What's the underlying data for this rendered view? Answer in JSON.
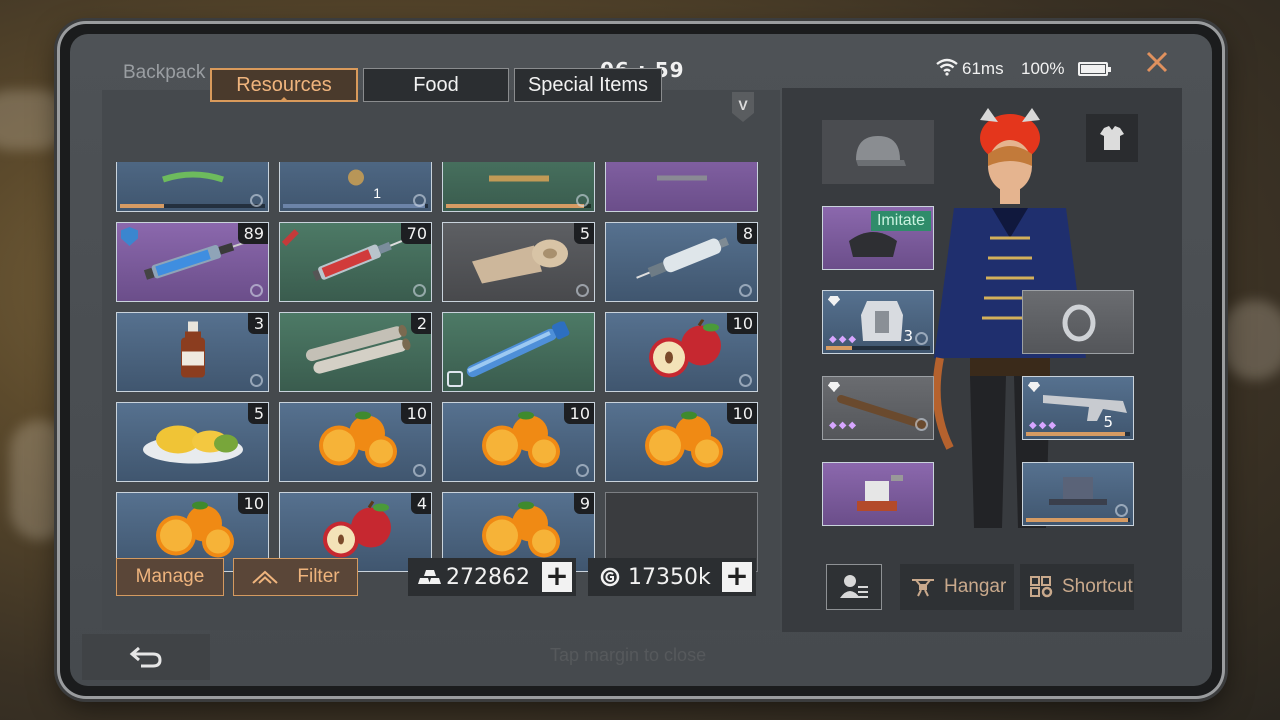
{
  "status_bar": {
    "title": "Backpack",
    "time": "06 : 59",
    "ping": "61ms",
    "battery": "100%"
  },
  "tabs": [
    {
      "label": "Resources",
      "active": true
    },
    {
      "label": "Food",
      "active": false
    },
    {
      "label": "Special Items",
      "active": false
    }
  ],
  "v_badge": "V",
  "items": [
    {
      "name": "partial-green-item",
      "rarity": "blue",
      "qty": ""
    },
    {
      "name": "partial-item",
      "rarity": "blue",
      "qty": "1"
    },
    {
      "name": "partial-item",
      "rarity": "green",
      "qty": ""
    },
    {
      "name": "partial-item",
      "rarity": "purple",
      "qty": ""
    },
    {
      "name": "blue-syringe",
      "rarity": "purple",
      "qty": "89"
    },
    {
      "name": "red-syringe",
      "rarity": "green",
      "qty": "70"
    },
    {
      "name": "bandage",
      "rarity": "gray",
      "qty": "5"
    },
    {
      "name": "white-syringe",
      "rarity": "blue",
      "qty": "8"
    },
    {
      "name": "medicine-bottle",
      "rarity": "blue",
      "qty": "3"
    },
    {
      "name": "logs",
      "rarity": "green",
      "qty": "2"
    },
    {
      "name": "blue-test-tube",
      "rarity": "green",
      "qty": ""
    },
    {
      "name": "apples",
      "rarity": "blue",
      "qty": "10"
    },
    {
      "name": "mango-plate",
      "rarity": "blue",
      "qty": "5"
    },
    {
      "name": "oranges",
      "rarity": "blue",
      "qty": "10"
    },
    {
      "name": "oranges",
      "rarity": "blue",
      "qty": "10"
    },
    {
      "name": "oranges",
      "rarity": "blue",
      "qty": "10"
    },
    {
      "name": "oranges",
      "rarity": "blue",
      "qty": "10"
    },
    {
      "name": "apples",
      "rarity": "blue",
      "qty": "4"
    },
    {
      "name": "oranges",
      "rarity": "blue",
      "qty": "9"
    },
    {
      "name": "empty-slot",
      "rarity": "empty",
      "qty": ""
    }
  ],
  "buttons": {
    "manage": "Manage",
    "filter": "Filter"
  },
  "currency": {
    "gold": "272862",
    "coins": "17350k"
  },
  "equipment": {
    "imitate_label": "Imitate",
    "vest_level": "3",
    "gun_level": "5"
  },
  "side_buttons": {
    "hangar": "Hangar",
    "shortcut": "Shortcut"
  },
  "footer": {
    "hint": "Tap margin to close"
  },
  "colors": {
    "accent": "#efb47d",
    "blue_rarity": "#56718f",
    "green_rarity": "#4d7a66",
    "purple_rarity": "#8b68ad"
  }
}
